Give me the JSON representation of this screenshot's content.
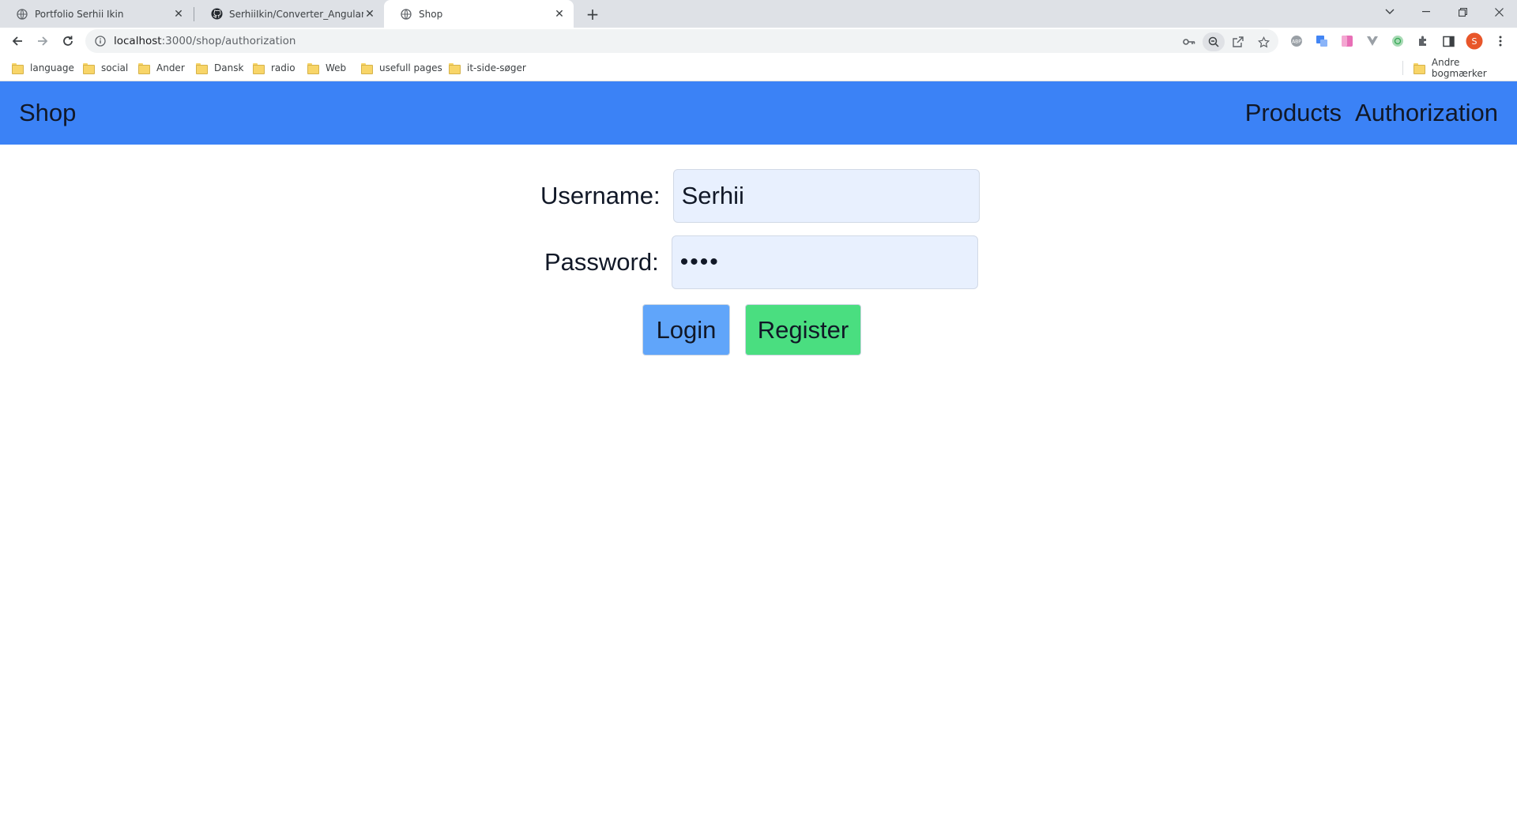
{
  "browser": {
    "tabs": [
      {
        "title": "Portfolio Serhii Ikin",
        "icon": "globe-icon",
        "active": false
      },
      {
        "title": "SerhiiIkin/Converter_Angular",
        "icon": "github-icon",
        "active": false
      },
      {
        "title": "Shop",
        "icon": "globe-icon",
        "active": true
      }
    ],
    "new_tab_label": "+",
    "url_host": "localhost",
    "url_rest": ":3000/shop/authorization",
    "bookmarks": [
      {
        "label": "language"
      },
      {
        "label": "social"
      },
      {
        "label": "Ander"
      },
      {
        "label": "Dansk"
      },
      {
        "label": "radio"
      },
      {
        "label": "Web"
      },
      {
        "label": "usefull pages"
      },
      {
        "label": "it-side-søger"
      }
    ],
    "other_bookmarks": "Andre bogmærker",
    "profile_initial": "S",
    "colors": {
      "tabstrip": "#dee1e6",
      "profile": "#e8562a",
      "folder": "#f8d568"
    }
  },
  "app": {
    "brand": "Shop",
    "nav": {
      "products": "Products",
      "authorization": "Authorization"
    },
    "colors": {
      "navbar": "#3b82f6",
      "login": "#60a5fa",
      "register": "#4ade80",
      "input_bg": "#e8f0fe"
    }
  },
  "auth_form": {
    "username_label": "Username:",
    "username_value": "Serhii",
    "password_label": "Password:",
    "password_value": "••••",
    "login_label": "Login",
    "register_label": "Register"
  }
}
